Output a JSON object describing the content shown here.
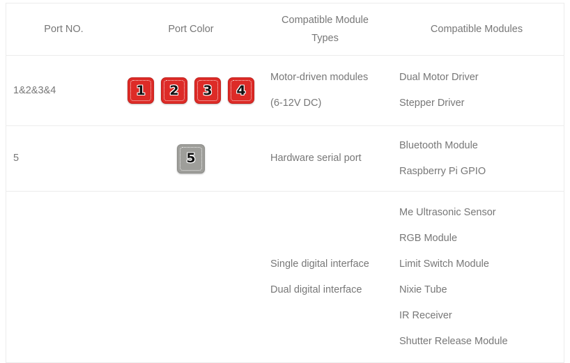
{
  "table": {
    "headers": [
      {
        "label": "Port NO."
      },
      {
        "label": "Port Color"
      },
      {
        "label_line1": "Compatible Module",
        "label_line2": "Types"
      },
      {
        "label": "Compatible Modules"
      }
    ],
    "rows": [
      {
        "port_no": "1&2&3&4",
        "badges": [
          {
            "number": "1",
            "color": "#dd2b27",
            "style": "red"
          },
          {
            "number": "2",
            "color": "#dd2b27",
            "style": "red"
          },
          {
            "number": "3",
            "color": "#dd2b27",
            "style": "red"
          },
          {
            "number": "4",
            "color": "#dd2b27",
            "style": "red"
          }
        ],
        "module_types": [
          "Motor-driven modules",
          "(6-12V DC)"
        ],
        "modules": [
          "Dual Motor Driver",
          "Stepper Driver"
        ]
      },
      {
        "port_no": "5",
        "badges": [
          {
            "number": "5",
            "color": "#9e9e9a",
            "style": "gray"
          }
        ],
        "module_types": [
          "Hardware serial port"
        ],
        "modules": [
          "Bluetooth Module",
          "Raspberry Pi GPIO"
        ]
      },
      {
        "port_no": "",
        "badges": [],
        "module_types": [
          "Single digital interface",
          "Dual digital interface"
        ],
        "modules": [
          "Me Ultrasonic Sensor",
          "RGB Module",
          "Limit Switch Module",
          "Nixie Tube",
          "IR Receiver",
          "Shutter Release Module"
        ]
      }
    ]
  },
  "colors": {
    "border": "#ececec",
    "text": "#777777",
    "badge_red": "#dd2b27",
    "badge_gray": "#9e9e9a",
    "badge_number": "#111111"
  }
}
